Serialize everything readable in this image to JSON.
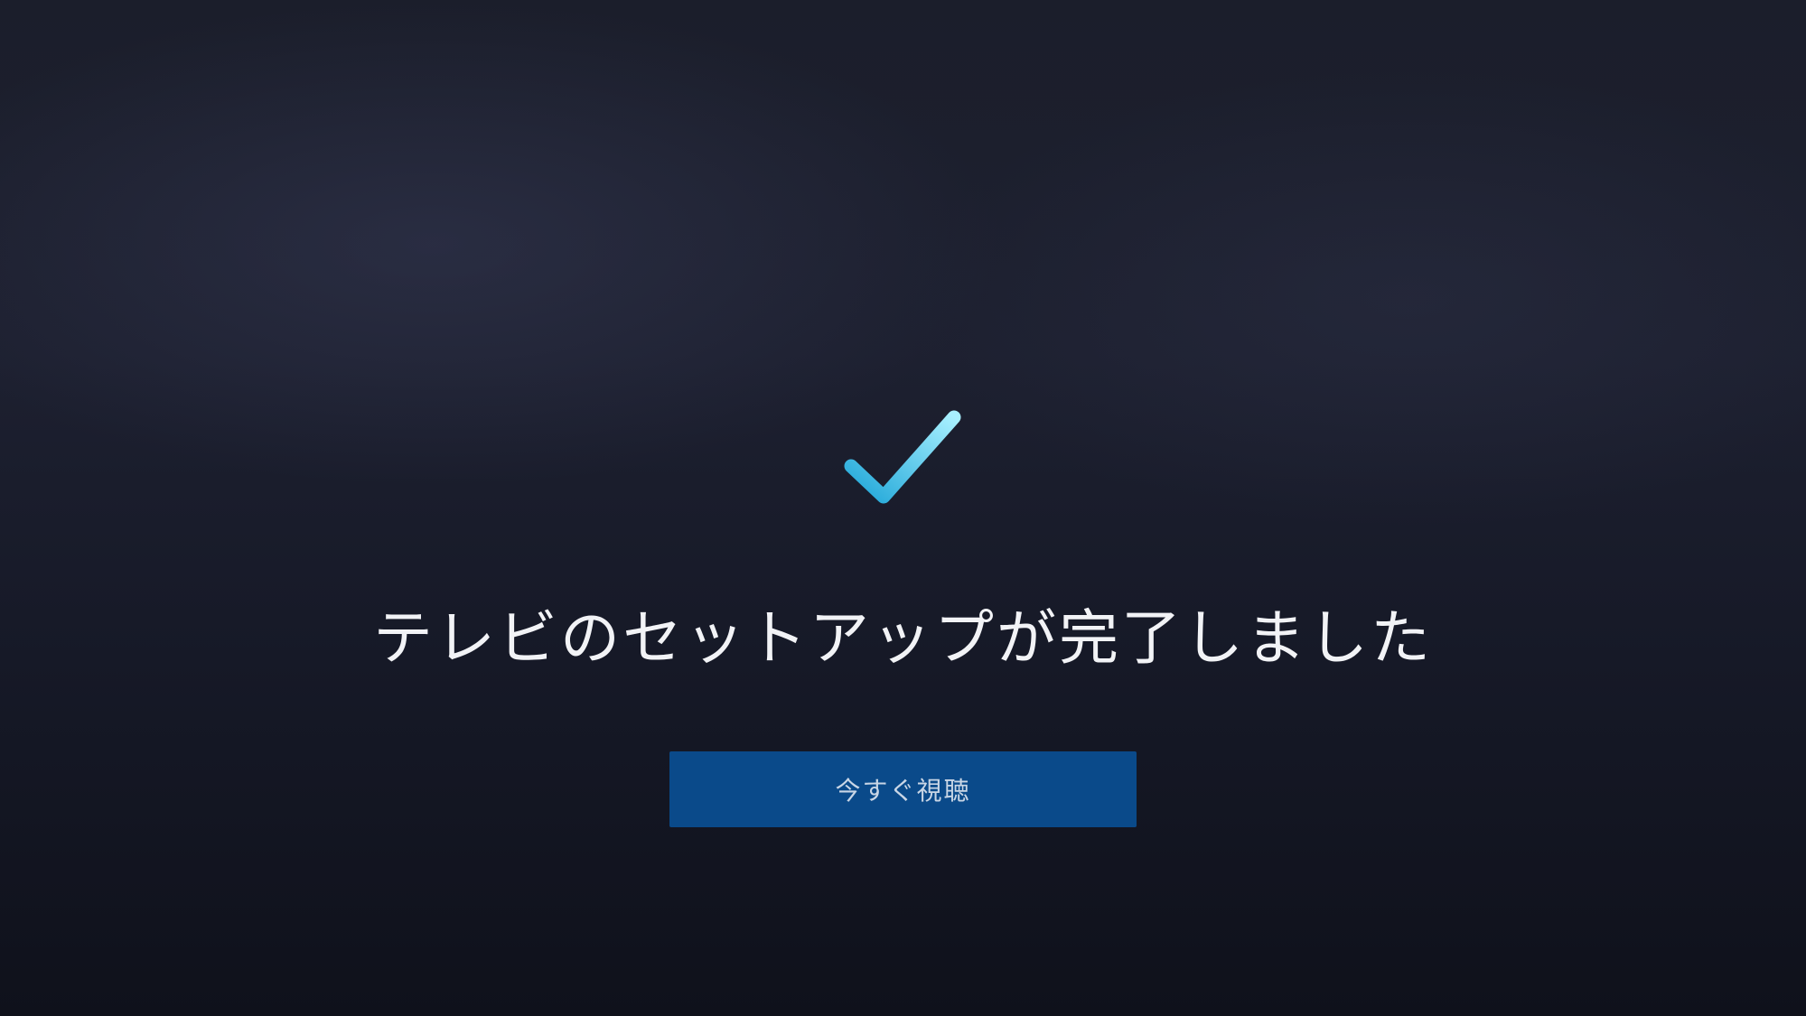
{
  "screen": {
    "icon": "checkmark-icon",
    "title": "テレビのセットアップが完了しました",
    "watch_button_label": "今すぐ視聴"
  },
  "colors": {
    "check_gradient_start": "#1fa6d8",
    "check_gradient_end": "#a8f0ff",
    "button_background": "#0a4a8a",
    "title_text": "#f2f3f6",
    "button_text": "#c9d6e6"
  }
}
